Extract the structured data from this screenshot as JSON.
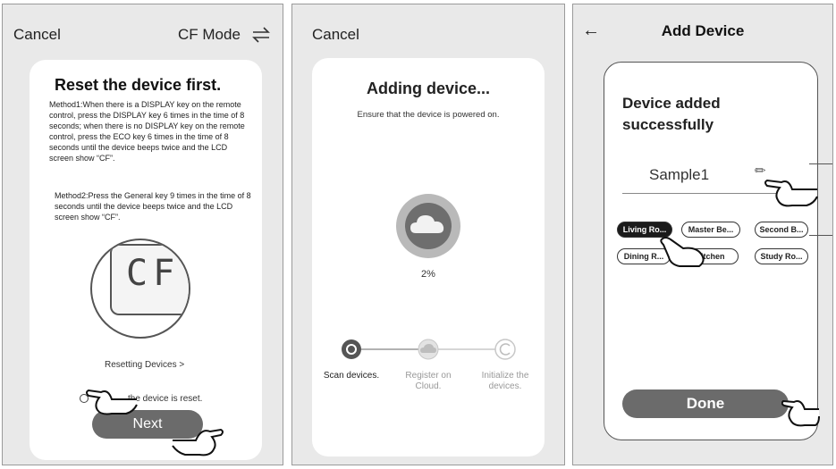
{
  "panel1": {
    "cancel": "Cancel",
    "mode_label": "CF Mode",
    "title": "Reset the device first.",
    "method1": "Method1:When there is a DISPLAY key on the remote control, press the DISPLAY key 6 times in the time of 8 seconds; when there is no DISPLAY key on the remote control, press the ECO key 6 times in the time of 8 seconds until the device beeps twice and the LCD screen show “CF”.",
    "method2": "Method2:Press the General key 9 times in the time of 8 seconds until the device beeps twice and the LCD screen show “CF”.",
    "display_text": "CF",
    "resetting_link": "Resetting Devices >",
    "confirm_text": "the device is reset.",
    "next_button": "Next"
  },
  "panel2": {
    "cancel": "Cancel",
    "title": "Adding device...",
    "subtitle": "Ensure that the device is powered on.",
    "progress_percent": "2%",
    "progress_value": 0.02,
    "steps": [
      {
        "label": "Scan devices.",
        "active": true
      },
      {
        "label": "Register on Cloud.",
        "active": false
      },
      {
        "label": "Initialize the devices.",
        "active": false
      }
    ]
  },
  "panel3": {
    "title": "Add Device",
    "success_text": "Device added successfully",
    "device_name": "Sample1",
    "rooms": [
      {
        "label": "Living Ro...",
        "selected": true
      },
      {
        "label": "Master Be...",
        "selected": false
      },
      {
        "label": "Second B...",
        "selected": false
      },
      {
        "label": "Dining R...",
        "selected": false
      },
      {
        "label": "Kitchen",
        "selected": false
      },
      {
        "label": "Study Ro...",
        "selected": false
      }
    ],
    "done_button": "Done"
  },
  "colors": {
    "background": "#e9e9e9",
    "card": "#ffffff",
    "button": "#6b6b6b",
    "selected_chip": "#1a1a1a",
    "progress_active": "#555555",
    "progress_inactive": "#c8c8c8"
  },
  "icons": [
    "swap-icon",
    "cloud-icon",
    "refresh-icon",
    "back-arrow-icon",
    "pencil-icon",
    "pointing-hand-icon"
  ]
}
